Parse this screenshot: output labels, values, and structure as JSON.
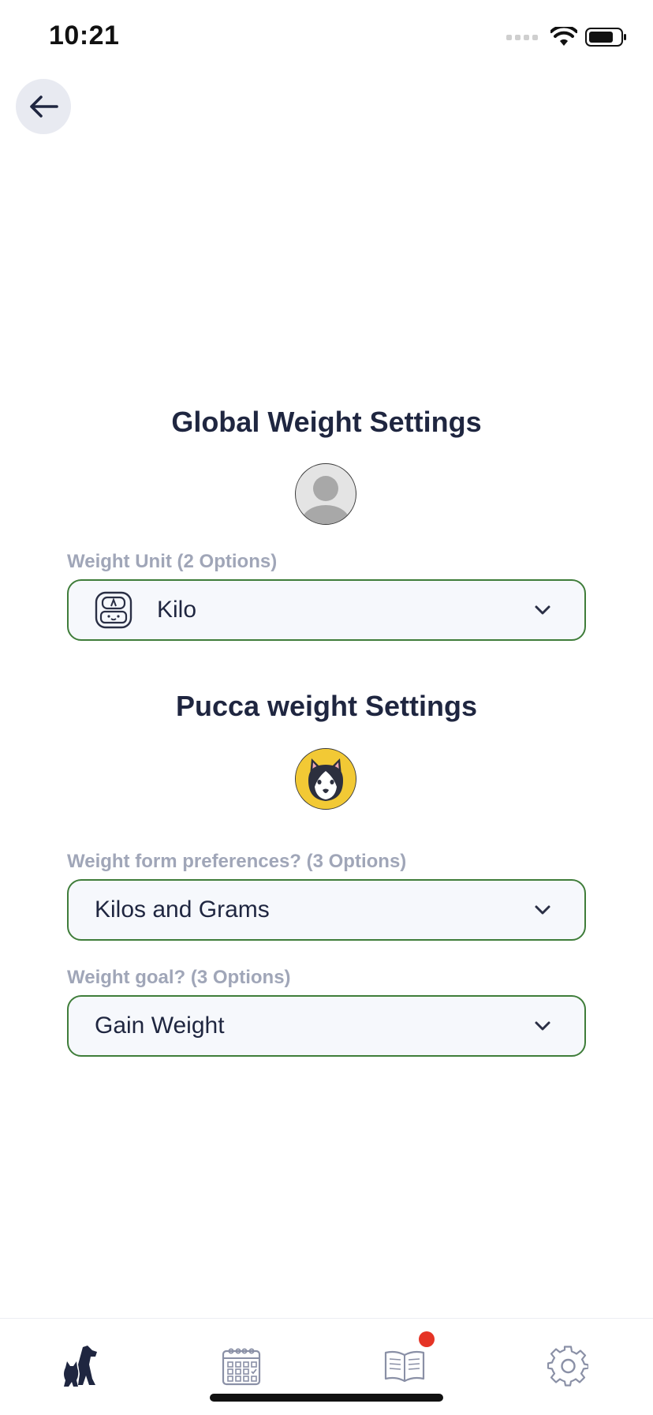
{
  "status_bar": {
    "time": "10:21",
    "icons": [
      "signal-icon",
      "wifi-icon",
      "battery-icon"
    ]
  },
  "header": {
    "back_icon": "arrow-left-icon"
  },
  "global_section": {
    "title": "Global Weight Settings",
    "avatar_icon": "user-placeholder-icon",
    "weight_unit": {
      "label": "Weight Unit (2 Options)",
      "icon": "scale-icon",
      "value": "Kilo"
    }
  },
  "pet_section": {
    "title": "Pucca weight Settings",
    "avatar_icon": "husky-dog-icon",
    "form_preference": {
      "label": "Weight form preferences? (3 Options)",
      "value": "Kilos and Grams"
    },
    "goal": {
      "label": "Weight goal? (3 Options)",
      "value": "Gain Weight"
    }
  },
  "tabbar": {
    "tabs": [
      {
        "icon": "pets-icon",
        "active": true
      },
      {
        "icon": "calendar-icon",
        "active": false
      },
      {
        "icon": "book-icon",
        "active": false,
        "badge": true
      },
      {
        "icon": "gear-icon",
        "active": false
      }
    ]
  },
  "colors": {
    "accent_border": "#3f7d3a",
    "title_text": "#1f2640",
    "label_text": "#a0a6b8",
    "badge": "#e53325",
    "field_bg": "#f6f8fc"
  }
}
